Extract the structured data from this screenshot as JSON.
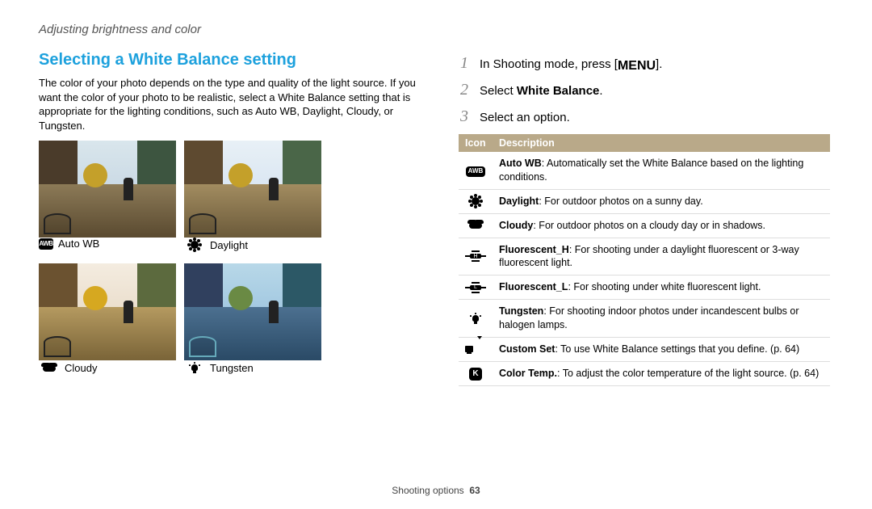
{
  "breadcrumb": "Adjusting brightness and color",
  "heading": "Selecting a White Balance setting",
  "intro": "The color of your photo depends on the type and quality of the light source. If you want the color of your photo to be realistic, select a White Balance setting that is appropriate for the lighting conditions, such as Auto WB, Daylight, Cloudy, or Tungsten.",
  "samples": {
    "autowb": "Auto WB",
    "daylight": "Daylight",
    "cloudy": "Cloudy",
    "tungsten": "Tungsten"
  },
  "steps": {
    "s1a": "In Shooting mode, press [",
    "s1_menu": "MENU",
    "s1b": "].",
    "s2a": "Select ",
    "s2b": "White Balance",
    "s2c": ".",
    "s3": "Select an option."
  },
  "table": {
    "h_icon": "Icon",
    "h_desc": "Description",
    "rows": [
      {
        "icon": "awb",
        "b": "Auto WB",
        "t": ": Automatically set the White Balance based on the lighting conditions."
      },
      {
        "icon": "sun",
        "b": "Daylight",
        "t": ": For outdoor photos on a sunny day."
      },
      {
        "icon": "cloud",
        "b": "Cloudy",
        "t": ": For outdoor photos on a cloudy day or in shadows."
      },
      {
        "icon": "fh",
        "b": "Fluorescent_H",
        "t": ": For shooting under a daylight fluorescent or 3-way fluorescent light."
      },
      {
        "icon": "fl",
        "b": "Fluorescent_L",
        "t": ": For shooting under white fluorescent light."
      },
      {
        "icon": "bulb",
        "b": "Tungsten",
        "t": ": For shooting indoor photos under incandescent bulbs or halogen lamps."
      },
      {
        "icon": "custom",
        "b": "Custom Set",
        "t": ": To use White Balance settings that you define. (p. 64)"
      },
      {
        "icon": "k",
        "b": "Color Temp.",
        "t": ": To adjust the color temperature of the light source. (p. 64)"
      }
    ]
  },
  "footer": {
    "section": "Shooting options",
    "page": "63"
  }
}
